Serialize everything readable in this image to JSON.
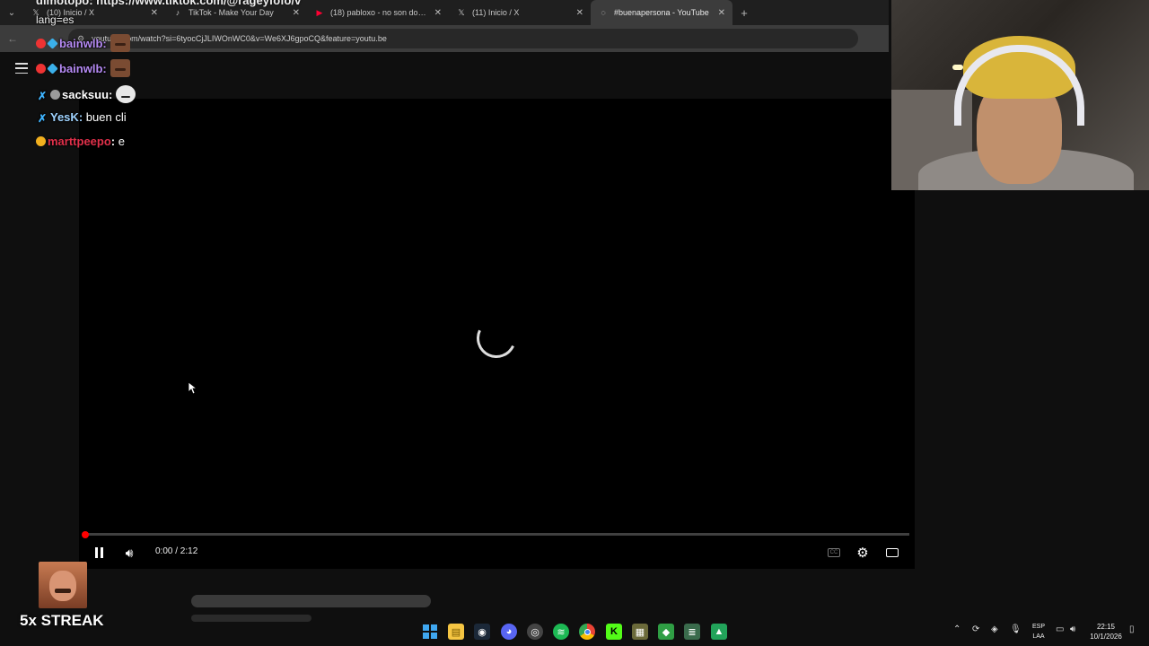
{
  "browser": {
    "tabs": [
      {
        "title": "(10) Inicio / X",
        "favicon": "x-logo"
      },
      {
        "title": "TikTok - Make Your Day",
        "favicon": "tiktok-logo"
      },
      {
        "title": "(18) pabloxo - no son dos f son",
        "favicon": "youtube-logo"
      },
      {
        "title": "(11) Inicio / X",
        "favicon": "x-logo"
      },
      {
        "title": "#buenapersona - YouTube",
        "favicon": "youtube-logo",
        "active": true
      }
    ],
    "new_tab": "+",
    "address": "youtube.com/watch?si=6tyocCjJLIWOnWC0&v=We6XJ6gpoCQ&feature=youtu.be"
  },
  "chat": {
    "header_text": "dimotopo: https://www.tiktok.com/@rageyfofo/v",
    "lang_text": "lang=es",
    "messages": [
      {
        "user": "bainwlb",
        "user_color": "#b68bf5",
        "text": ""
      },
      {
        "user": "bainwlb",
        "user_color": "#b68bf5",
        "text": ""
      },
      {
        "user": "sacksuu",
        "user_color": "#ffffff",
        "text": ""
      },
      {
        "user": "YesK",
        "user_color": "#9fd3ff",
        "text": "buen cli"
      },
      {
        "user": "marttpeepo",
        "user_color": "#e0304a",
        "text": "e"
      }
    ]
  },
  "player": {
    "time": "0:00 / 2:12",
    "progress": 0,
    "cc_label": "CC"
  },
  "streak": {
    "label": "5x STREAK"
  },
  "taskbar": {
    "lang_top": "ESP",
    "lang_bottom": "LAA",
    "time": "22:15",
    "date": "10/1/2026"
  }
}
